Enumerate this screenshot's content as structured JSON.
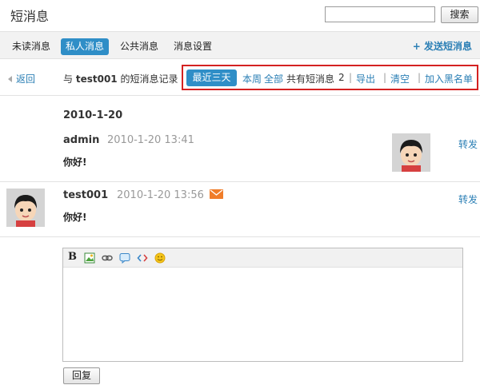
{
  "page": {
    "title": "短消息"
  },
  "search": {
    "value": "",
    "button_label": "搜索"
  },
  "tabs": [
    {
      "label": "未读消息",
      "active": false
    },
    {
      "label": "私人消息",
      "active": true
    },
    {
      "label": "公共消息",
      "active": false
    },
    {
      "label": "消息设置",
      "active": false
    }
  ],
  "send_link": "+ 发送短消息",
  "filter": {
    "back_label": "返回",
    "record_prefix": "与",
    "record_user": "test001",
    "record_suffix": "的短消息记录",
    "ranges": [
      {
        "label": "最近三天",
        "active": true
      },
      {
        "label": "本周",
        "active": false
      },
      {
        "label": "全部",
        "active": false
      }
    ],
    "total_label": "共有短消息",
    "total_count": "2",
    "actions": [
      "导出",
      "清空",
      "加入黑名单"
    ]
  },
  "conversation": {
    "date": "2010-1-20",
    "messages": [
      {
        "user": "admin",
        "time": "2010-1-20 13:41",
        "body": "你好!",
        "action": "转发",
        "unread_icon": false
      },
      {
        "user": "test001",
        "time": "2010-1-20 13:56",
        "body": "你好!",
        "action": "转发",
        "unread_icon": true
      }
    ]
  },
  "editor": {
    "toolbar": [
      "bold-icon",
      "image-icon",
      "link-icon",
      "quote-icon",
      "code-icon",
      "smiley-icon"
    ],
    "bold_label": "B",
    "content": ""
  },
  "reply": {
    "button_label": "回复"
  },
  "colors": {
    "accent": "#2f8ec7",
    "link": "#2b7fb5",
    "highlight_border": "#d42121",
    "mail_icon": "#f07d2a"
  }
}
